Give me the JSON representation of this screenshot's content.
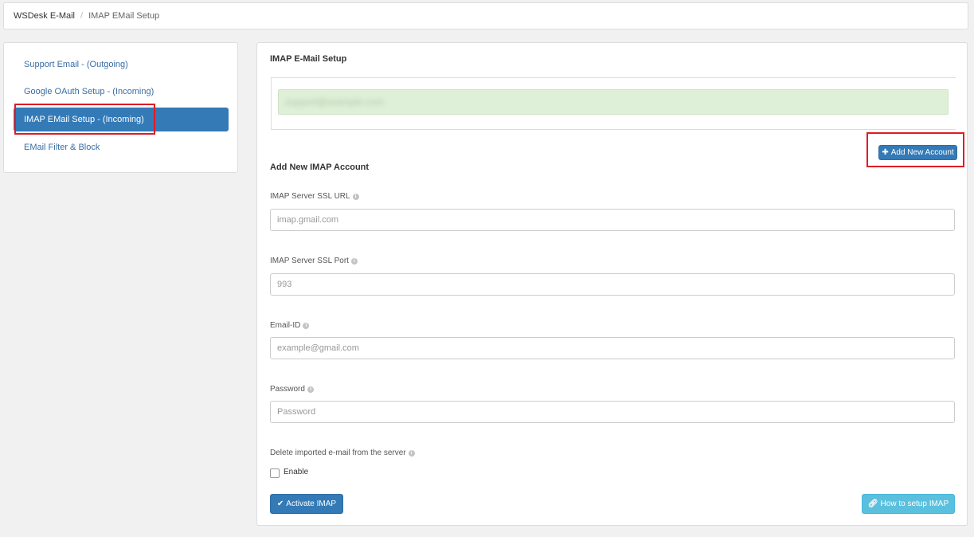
{
  "breadcrumb": {
    "root": "WSDesk E-Mail",
    "separator": "/",
    "current": "IMAP EMail Setup"
  },
  "sidebar": {
    "items": [
      {
        "label": "Support Email - (Outgoing)"
      },
      {
        "label": "Google OAuth Setup - (Incoming)"
      },
      {
        "label": "IMAP EMail Setup - (Incoming)"
      },
      {
        "label": "EMail Filter & Block"
      }
    ]
  },
  "main": {
    "title": "IMAP E-Mail Setup",
    "account_email": "support@example.com",
    "add_account_button": "Add New Account",
    "section_title": "Add New IMAP Account",
    "fields": {
      "server_url": {
        "label": "IMAP Server SSL URL",
        "placeholder": "imap.gmail.com"
      },
      "server_port": {
        "label": "IMAP Server SSL Port",
        "placeholder": "993"
      },
      "email_id": {
        "label": "Email-ID",
        "placeholder": "example@gmail.com"
      },
      "password": {
        "label": "Password",
        "placeholder": "Password"
      }
    },
    "delete_label": "Delete imported e-mail from the server",
    "enable_label": "Enable",
    "activate_button": "Activate IMAP",
    "howto_button": "How to setup IMAP"
  },
  "icons": {
    "info": "info-circle",
    "plus": "plus",
    "check": "check",
    "link": "link"
  },
  "colors": {
    "primary": "#337ab7",
    "info": "#5bc0de",
    "success_bg": "#dff0d8",
    "highlight": "#e01b24"
  }
}
